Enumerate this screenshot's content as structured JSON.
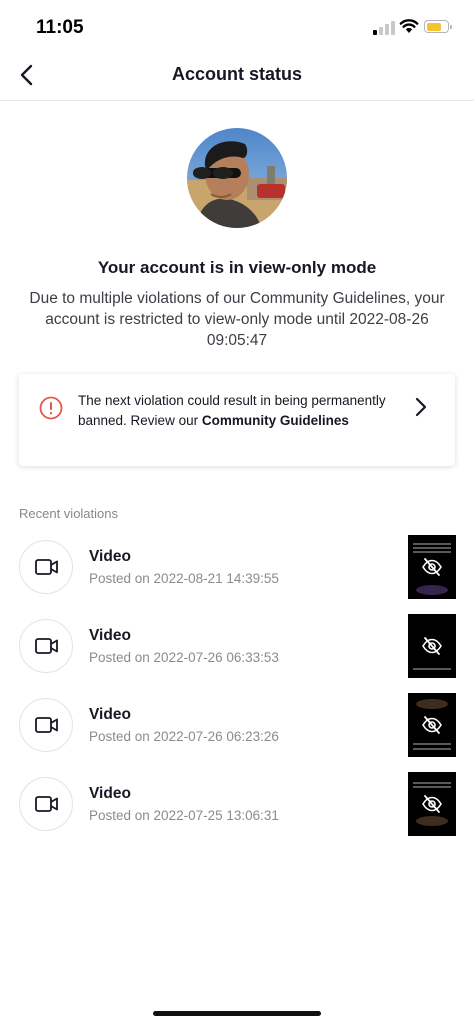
{
  "status_bar": {
    "time": "11:05"
  },
  "header": {
    "title": "Account status"
  },
  "status": {
    "headline": "Your account is in view-only mode",
    "description": "Due to multiple violations of our Community Guidelines, your account is restricted to view-only mode until 2022-08-26 09:05:47"
  },
  "warning_card": {
    "text": "The next violation could result in being permanently banned. Review our ",
    "link_text": "Community Guidelines"
  },
  "violations": {
    "section_label": "Recent violations",
    "items": [
      {
        "type": "Video",
        "posted": "Posted on 2022-08-21 14:39:55"
      },
      {
        "type": "Video",
        "posted": "Posted on 2022-07-26 06:33:53"
      },
      {
        "type": "Video",
        "posted": "Posted on 2022-07-26 06:23:26"
      },
      {
        "type": "Video",
        "posted": "Posted on 2022-07-25 13:06:31"
      }
    ]
  },
  "colors": {
    "warning_red": "#e4574c",
    "battery_yellow": "#f4c430",
    "secondary_text": "#8a8b91"
  },
  "icons": [
    "back-arrow-icon",
    "warning-circle-icon",
    "chevron-right-icon",
    "video-camera-icon",
    "hidden-eye-icon"
  ]
}
